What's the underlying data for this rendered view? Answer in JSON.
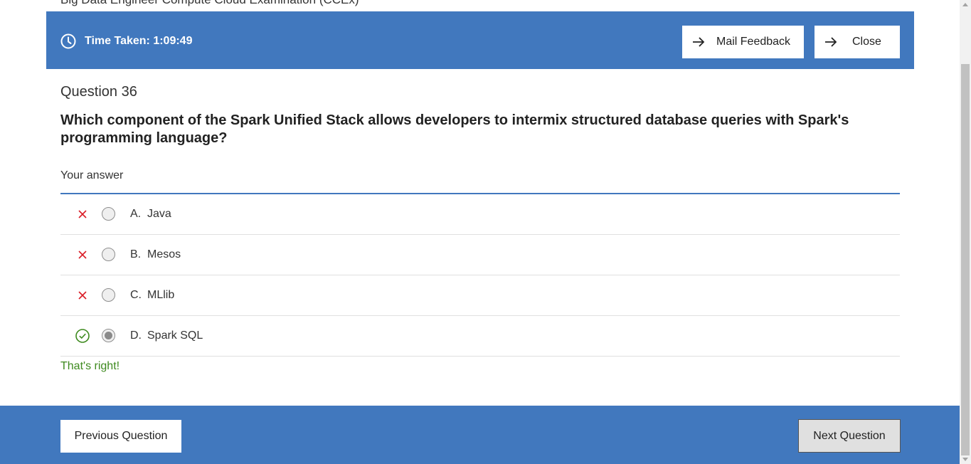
{
  "top_sliver_text": "Big Data Engineer Compute Cloud Examination (CCEx)",
  "header": {
    "timer_label": "Time Taken: 1:09:49",
    "mail_feedback_label": "Mail Feedback",
    "close_label": "Close"
  },
  "question": {
    "number_label": "Question 36",
    "text": "Which component of the Spark Unified Stack allows developers to intermix structured database queries with Spark's programming language?"
  },
  "answer_section_label": "Your answer",
  "options": [
    {
      "letter": "A.",
      "text": "Java",
      "status": "incorrect",
      "selected": false
    },
    {
      "letter": "B.",
      "text": "Mesos",
      "status": "incorrect",
      "selected": false
    },
    {
      "letter": "C.",
      "text": "MLlib",
      "status": "incorrect",
      "selected": false
    },
    {
      "letter": "D.",
      "text": "Spark SQL",
      "status": "correct",
      "selected": true
    }
  ],
  "feedback": "That's right!",
  "footer": {
    "previous_label": "Previous Question",
    "next_label": "Next Question"
  },
  "colors": {
    "accent": "#4178be",
    "correct": "#3e8a1f",
    "incorrect": "#da1e28"
  }
}
